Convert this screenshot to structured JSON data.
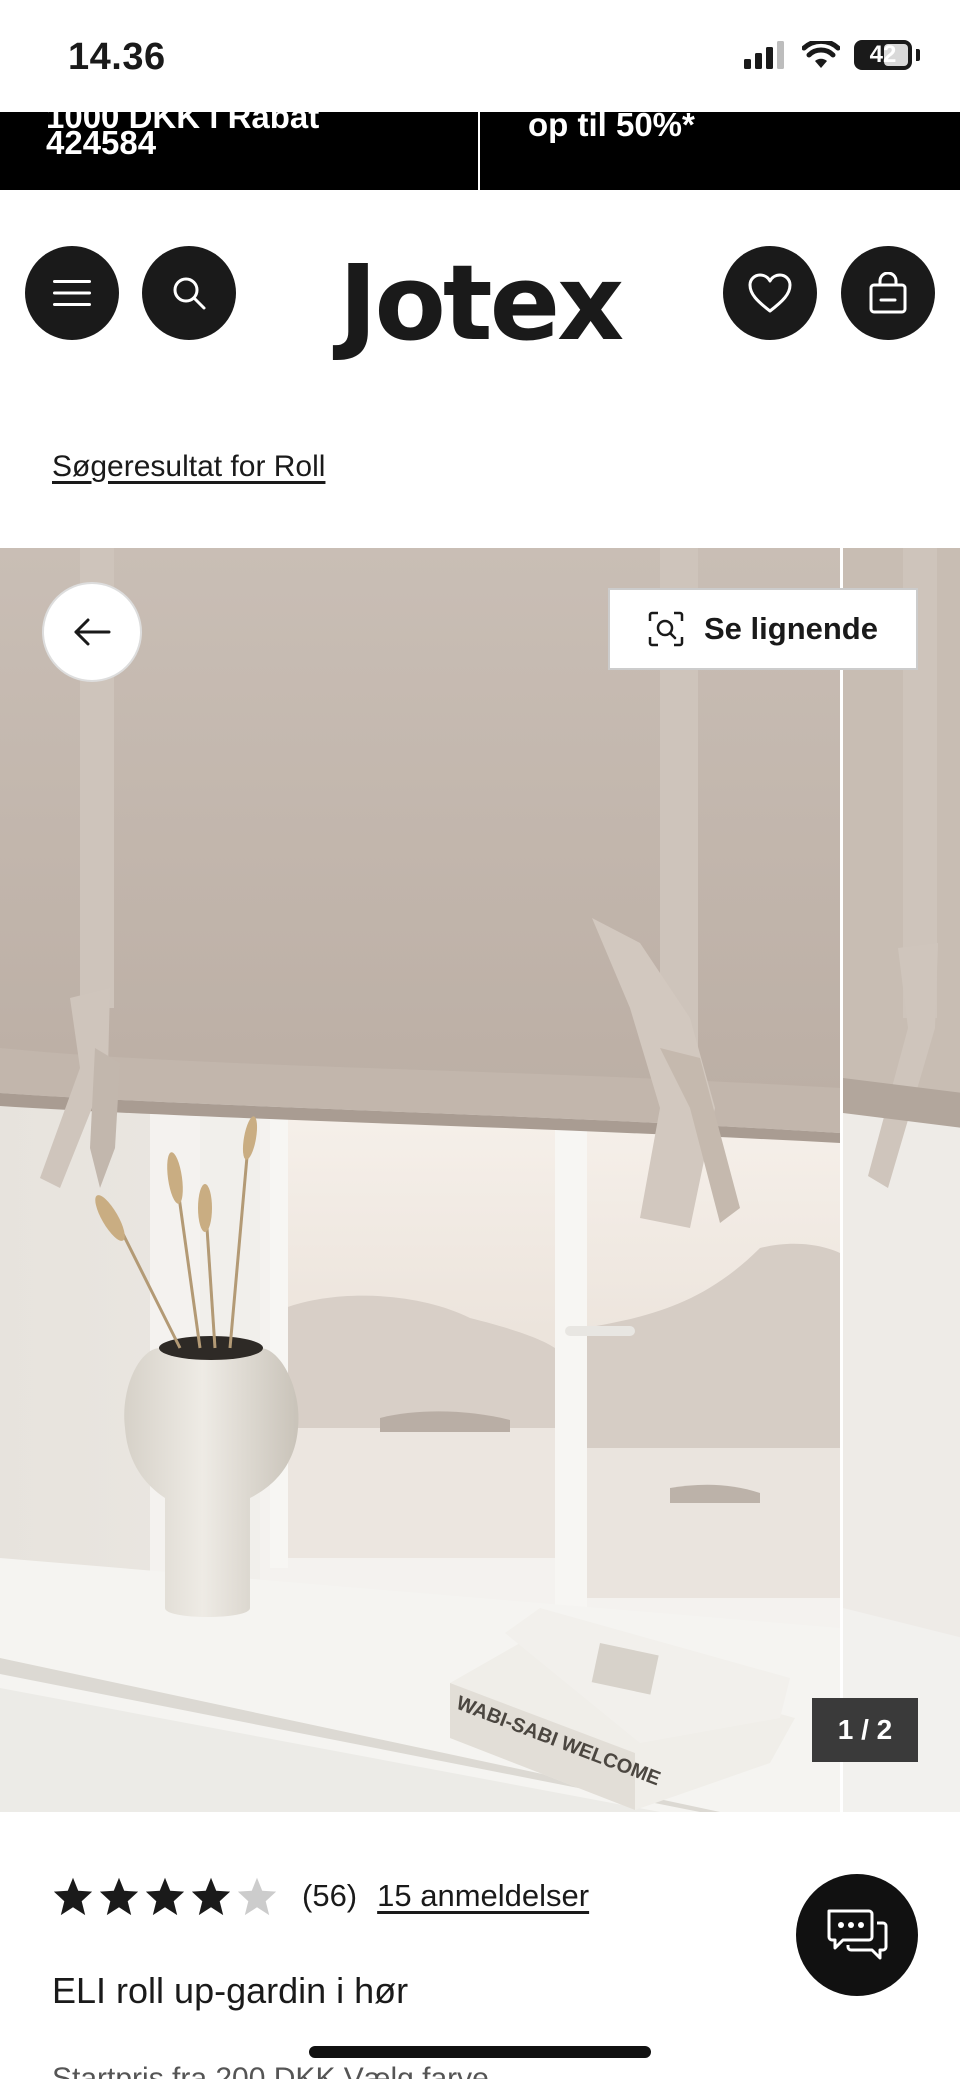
{
  "status_bar": {
    "time": "14.36",
    "battery": "42",
    "icons": [
      "signal-icon",
      "wifi-icon",
      "battery-icon"
    ]
  },
  "promo": {
    "left_line1": "1000 DKK i Rabat",
    "left_line2": "424584",
    "right_line": "op til 50%*"
  },
  "header": {
    "logo": "Jotex",
    "icons": [
      "menu-icon",
      "search-icon",
      "heart-icon",
      "bag-icon"
    ]
  },
  "breadcrumb": "Søgeresultat for Roll",
  "gallery": {
    "similar_label": "Se lignende",
    "counter": "1 / 2",
    "book_text": "WABI-SABI WELCOME"
  },
  "product": {
    "rating": 4,
    "max_rating": 5,
    "review_count": "(56)",
    "reviews_link": "15 anmeldelser",
    "title": "ELI roll up-gardin i hør",
    "price_line": "Startpris fra 200 DKK  Vælg farve"
  },
  "colors": {
    "dark": "#1a1a1a",
    "banner": "#000000",
    "linen": "#c8bdb3"
  }
}
